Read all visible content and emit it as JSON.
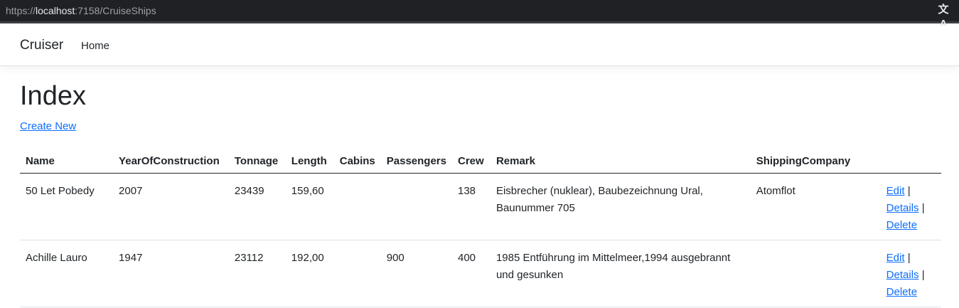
{
  "browser": {
    "url_prefix": "https://",
    "url_host": "localhost",
    "url_rest": ":7158/CruiseShips",
    "translate_icon": "文A"
  },
  "nav": {
    "brand": "Cruiser",
    "home": "Home"
  },
  "page": {
    "title": "Index",
    "create_new": "Create New"
  },
  "table": {
    "headers": [
      "Name",
      "YearOfConstruction",
      "Tonnage",
      "Length",
      "Cabins",
      "Passengers",
      "Crew",
      "Remark",
      "ShippingCompany"
    ],
    "rows": [
      {
        "name": "50 Let Pobedy",
        "year": "2007",
        "tonnage": "23439",
        "length": "159,60",
        "cabins": "",
        "passengers": "",
        "crew": "138",
        "remark": "Eisbrecher (nuklear), Baubezeichnung Ural, Baunummer 705",
        "company": "Atomflot"
      },
      {
        "name": "Achille Lauro",
        "year": "1947",
        "tonnage": "23112",
        "length": "192,00",
        "cabins": "",
        "passengers": "900",
        "crew": "400",
        "remark": "1985 Entführung im Mittelmeer,1994 ausgebrannt und gesunken",
        "company": ""
      }
    ],
    "actions": {
      "edit": "Edit",
      "details": "Details",
      "delete": "Delete",
      "separator": "|"
    }
  }
}
